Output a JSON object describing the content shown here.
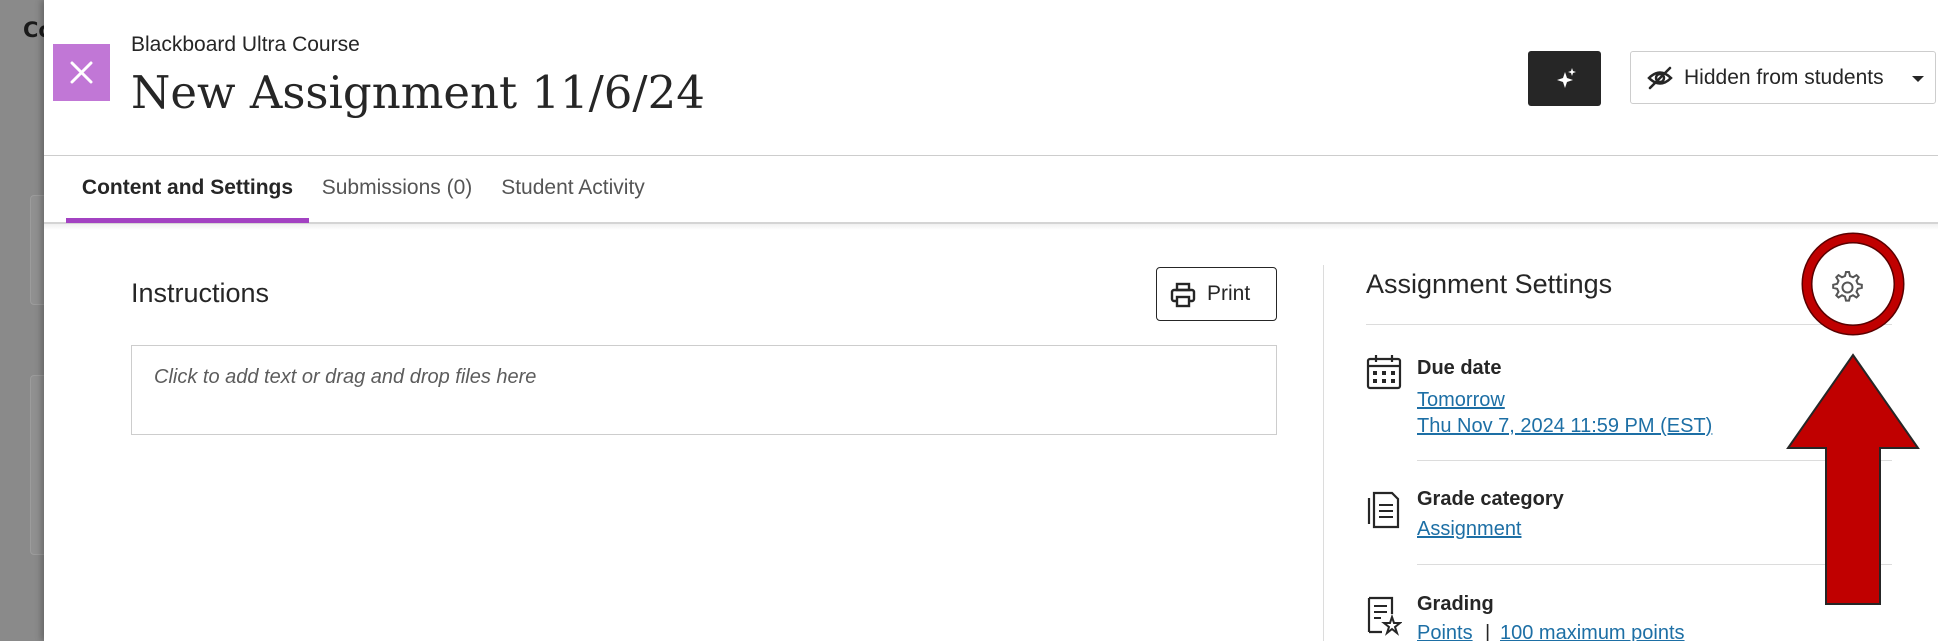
{
  "underlay": {
    "text": "Co"
  },
  "header": {
    "course_name": "Blackboard Ultra Course",
    "title": "New Assignment 11/6/24",
    "visibility_label": "Hidden from students"
  },
  "tabs": [
    {
      "label": "Content and Settings",
      "active": true
    },
    {
      "label": "Submissions (0)",
      "active": false
    },
    {
      "label": "Student Activity",
      "active": false
    }
  ],
  "instructions": {
    "title": "Instructions",
    "print_label": "Print",
    "placeholder": "Click to add text or drag and drop files here"
  },
  "settings": {
    "title": "Assignment Settings",
    "due_date": {
      "label": "Due date",
      "relative": "Tomorrow",
      "absolute": "Thu Nov 7, 2024 11:59 PM (EST)"
    },
    "grade_category": {
      "label": "Grade category",
      "value": "Assignment"
    },
    "grading": {
      "label": "Grading",
      "scheme": "Points",
      "separator": "|",
      "max_points": "100 maximum points"
    }
  },
  "colors": {
    "accent_purple": "#a342c2",
    "close_button": "#c177d6",
    "link_blue": "#1d6fa5",
    "annotation_red": "#c00000"
  },
  "icons": {
    "close": "close-icon",
    "ai": "sparkle-icon",
    "visibility": "eye-slash-icon",
    "print": "printer-icon",
    "settings": "gear-icon",
    "due_date": "calendar-icon",
    "grade_category": "document-icon",
    "grading": "rubric-icon"
  }
}
